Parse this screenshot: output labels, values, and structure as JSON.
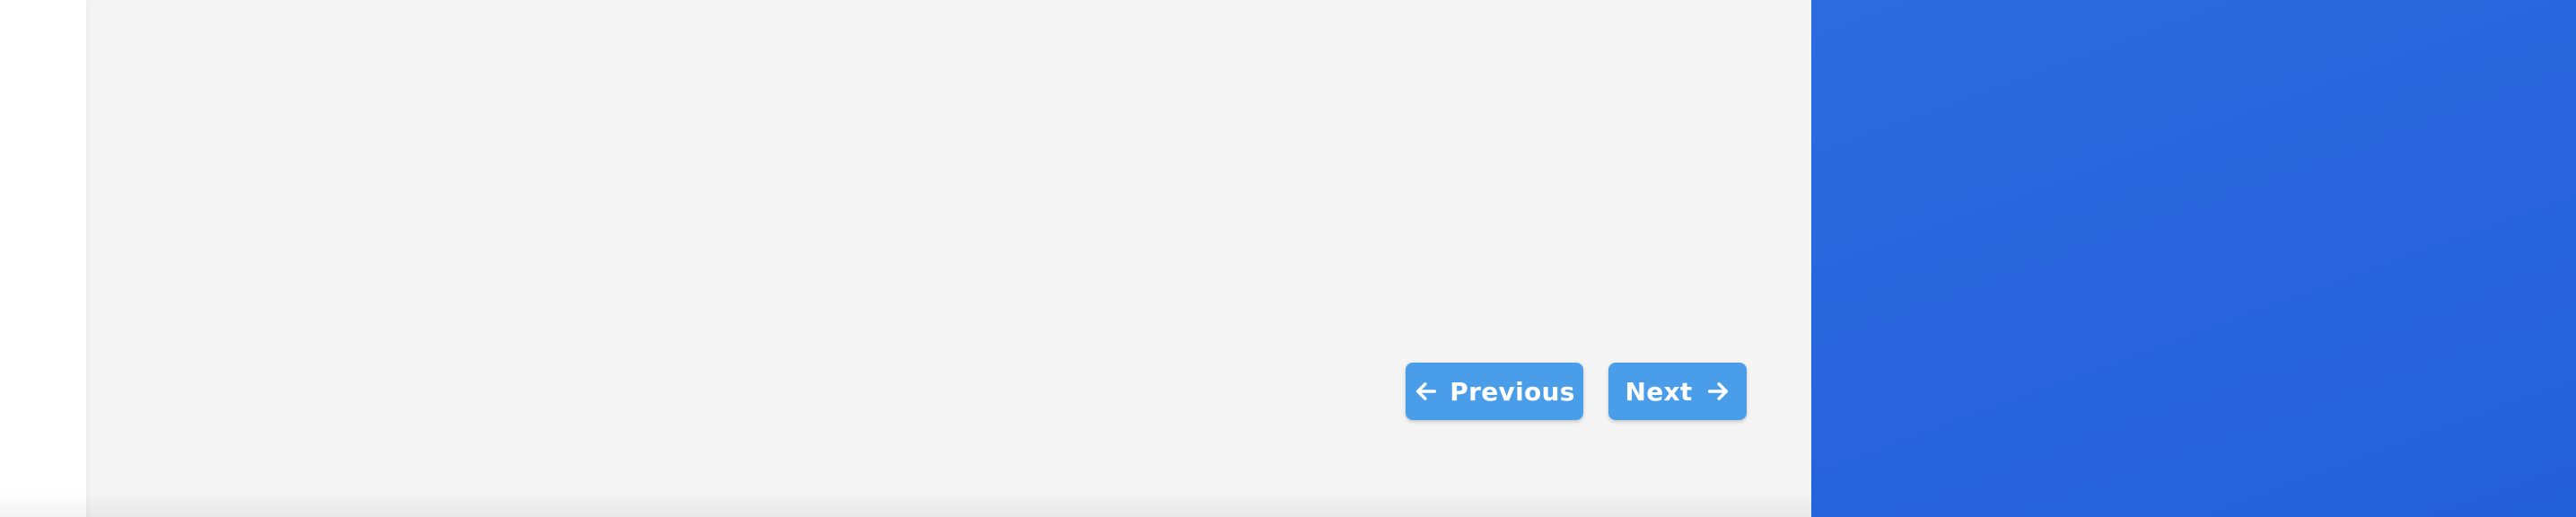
{
  "navigation": {
    "previous_label": "Previous",
    "next_label": "Next",
    "previous_icon": "arrow-left-icon",
    "next_icon": "arrow-right-icon"
  },
  "colors": {
    "content_background": "#f4f4f4",
    "button_background": "#4a9de9",
    "button_text": "#ffffff",
    "side_panel": "#2764de"
  }
}
